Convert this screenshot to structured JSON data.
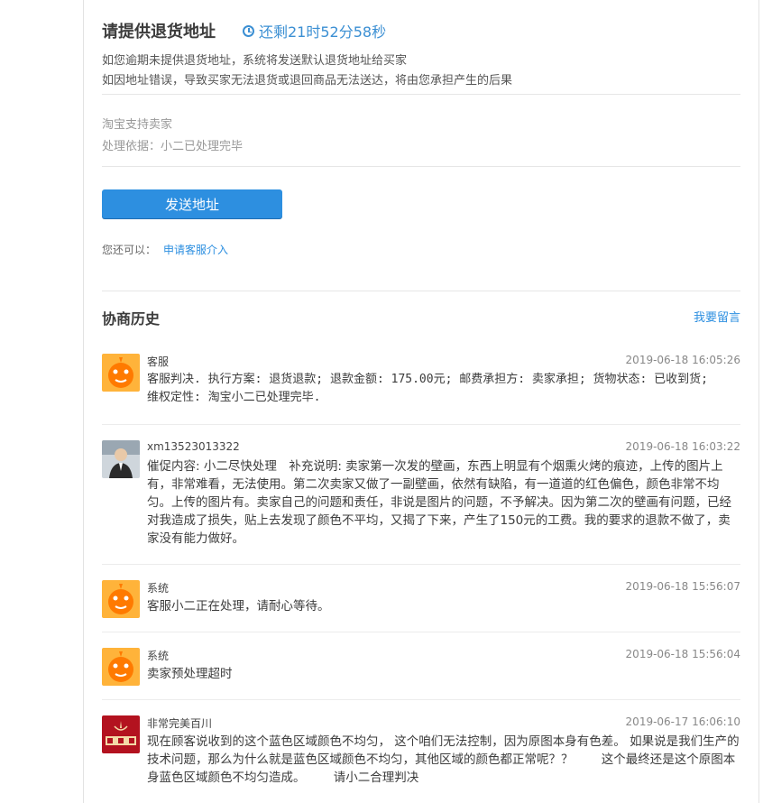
{
  "header": {
    "title": "请提供退货地址",
    "countdown": "还剩21时52分58秒",
    "note1": "如您逾期未提供退货地址，系统将发送默认退货地址给买家",
    "note2": "如因地址错误，导致买家无法退货或退回商品无法送达，将由您承担产生的后果"
  },
  "support": {
    "line1": "淘宝支持卖家",
    "line2": "处理依据：小二已处理完毕"
  },
  "actions": {
    "send_label": "发送地址",
    "also_label": "您还可以：",
    "apply_label": "申请客服介入"
  },
  "history": {
    "title": "协商历史",
    "leave_msg": "我要留言",
    "messages": [
      {
        "author": "客服",
        "time": "2019-06-18 16:05:26",
        "text": "客服判决. 执行方案: 退货退款; 退款金额: 175.00元; 邮费承担方: 卖家承担; 货物状态: 已收到货; 维权定性: 淘宝小二已处理完毕."
      },
      {
        "author": "xm13523013322",
        "time": "2019-06-18 16:03:22",
        "text": "催促内容: 小二尽快处理　补充说明: 卖家第一次发的壁画，东西上明显有个烟熏火烤的痕迹，上传的图片上有，非常难看，无法使用。第二次卖家又做了一副壁画，依然有缺陷，有一道道的红色偏色，颜色非常不均匀。上传的图片有。卖家自己的问题和责任，非说是图片的问题，不予解决。因为第二次的壁画有问题，已经对我造成了损失，贴上去发现了颜色不平均，又揭了下来，产生了150元的工费。我的要求的退款不做了，卖家没有能力做好。"
      },
      {
        "author": "系统",
        "time": "2019-06-18 15:56:07",
        "text": "客服小二正在处理，请耐心等待。"
      },
      {
        "author": "系统",
        "time": "2019-06-18 15:56:04",
        "text": "卖家预处理超时"
      },
      {
        "author": "非常完美百川",
        "time": "2019-06-17 16:06:10",
        "text": "现在顾客说收到的这个蓝色区域颜色不均匀， 这个咱们无法控制，因为原图本身有色差。 如果说是我们生产的技术问题，那么为什么就是蓝色区域颜色不均匀，其他区域的颜色都正常呢？？ 　　这个最终还是这个原图本身蓝色区域颜色不均匀造成。 　　请小二合理判决"
      }
    ]
  },
  "colors": {
    "accent": "#2d8fe0",
    "countdown": "#3b8fd3"
  }
}
